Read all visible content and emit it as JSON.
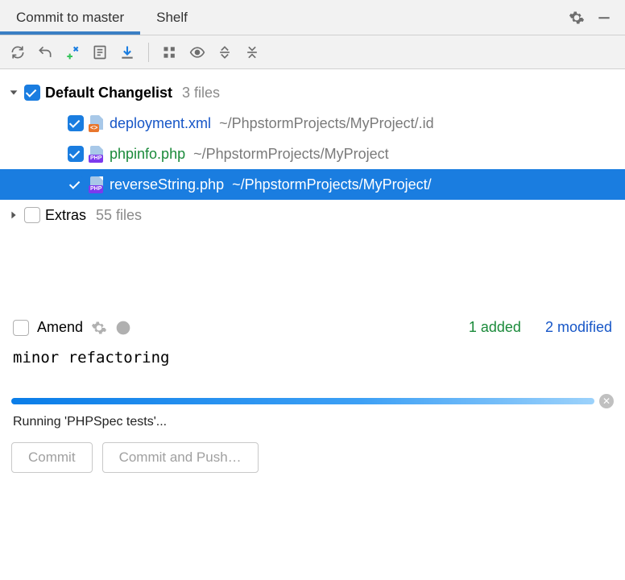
{
  "tabs": {
    "commit": "Commit to master",
    "shelf": "Shelf"
  },
  "changelists": [
    {
      "name": "Default Changelist",
      "count": "3 files",
      "expanded": true,
      "checked": true,
      "items": [
        {
          "filename": "deployment.xml",
          "path": "~/PhpstormProjects/MyProject/.id",
          "color": "blue",
          "badge": "<>",
          "badgeClass": "xml",
          "checked": true,
          "selected": false
        },
        {
          "filename": "phpinfo.php",
          "path": "~/PhpstormProjects/MyProject",
          "color": "green",
          "badge": "PHP",
          "badgeClass": "php",
          "checked": true,
          "selected": false
        },
        {
          "filename": "reverseString.php",
          "path": "~/PhpstormProjects/MyProject/",
          "color": "white",
          "badge": "PHP",
          "badgeClass": "php",
          "checked": true,
          "selected": true
        }
      ]
    },
    {
      "name": "Extras",
      "count": "55 files",
      "expanded": false,
      "checked": false,
      "items": []
    }
  ],
  "amend": {
    "label": "Amend",
    "checked": false
  },
  "summary": {
    "added": "1 added",
    "modified": "2 modified"
  },
  "commit_message": "minor refactoring",
  "status": "Running 'PHPSpec tests'...",
  "buttons": {
    "commit": "Commit",
    "commit_push": "Commit and Push…"
  }
}
